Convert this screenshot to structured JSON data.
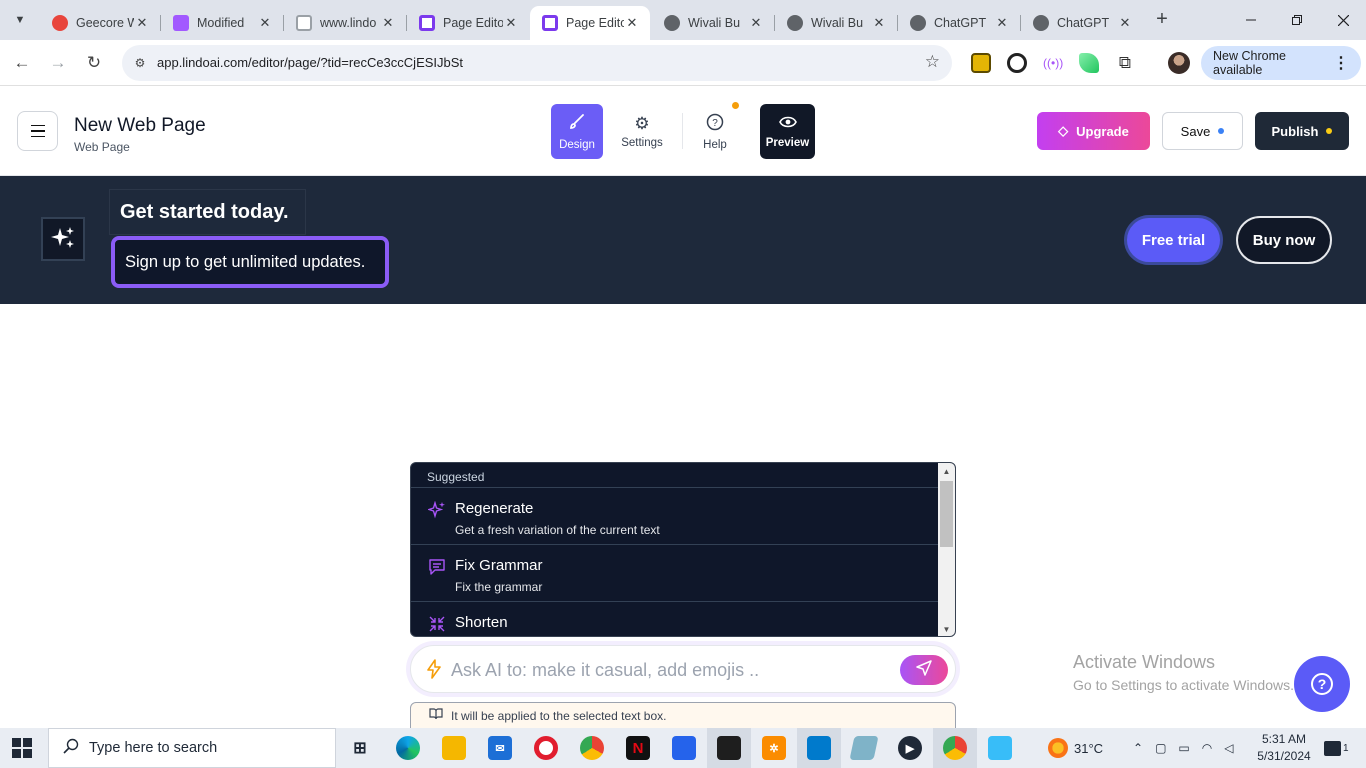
{
  "browser": {
    "tabs": [
      {
        "title": "Geecore W",
        "favicon_color": "#e8453c"
      },
      {
        "title": "Modified",
        "favicon_color": "#a259ff"
      },
      {
        "title": "www.lindo",
        "favicon_color": "#9aa0a6"
      },
      {
        "title": "Page Edito",
        "favicon_color": "#7c3aed"
      },
      {
        "title": "Page Edito",
        "favicon_color": "#7c3aed",
        "active": true
      },
      {
        "title": "Wivali Bu",
        "favicon_color": "#5f6368"
      },
      {
        "title": "Wivali Bu",
        "favicon_color": "#5f6368"
      },
      {
        "title": "ChatGPT",
        "favicon_color": "#5f6368"
      },
      {
        "title": "ChatGPT",
        "favicon_color": "#5f6368"
      }
    ],
    "close_glyph": "✕",
    "new_tab_glyph": "+",
    "url": "app.lindoai.com/editor/page/?tid=recCe3ccCjESIJbSt",
    "update_label": "New Chrome available"
  },
  "editor": {
    "page_title": "New Web Page",
    "page_type": "Web Page",
    "modes": {
      "design": "Design",
      "settings": "Settings",
      "help": "Help",
      "preview": "Preview"
    },
    "upgrade_label": "Upgrade",
    "save_label": "Save",
    "publish_label": "Publish"
  },
  "banner": {
    "heading": "Get started today.",
    "subheading": "Sign up to get unlimited updates.",
    "free_trial_label": "Free trial",
    "buy_now_label": "Buy now"
  },
  "ai": {
    "section_label": "Suggested",
    "items": [
      {
        "title": "Regenerate",
        "description": "Get a fresh variation of the current text",
        "icon": "sparkles-icon"
      },
      {
        "title": "Fix Grammar",
        "description": "Fix the grammar",
        "icon": "message-edit-icon"
      },
      {
        "title": "Shorten",
        "description": "",
        "icon": "shrink-icon"
      }
    ],
    "input_placeholder": "Ask AI to: make it casual, add emojis ..",
    "note": "It will be applied to the selected text box."
  },
  "windows": {
    "activate_title": "Activate Windows",
    "activate_sub": "Go to Settings to activate Windows.",
    "search_placeholder": "Type here to search",
    "weather": "31°C",
    "time": "5:31 AM",
    "date": "5/31/2024",
    "notification_count": "1"
  },
  "colors": {
    "accent": "#6b5df6",
    "banner_bg": "#1e293b",
    "ai_panel_bg": "#0f172a",
    "highlight_border": "#8b5cf6"
  }
}
